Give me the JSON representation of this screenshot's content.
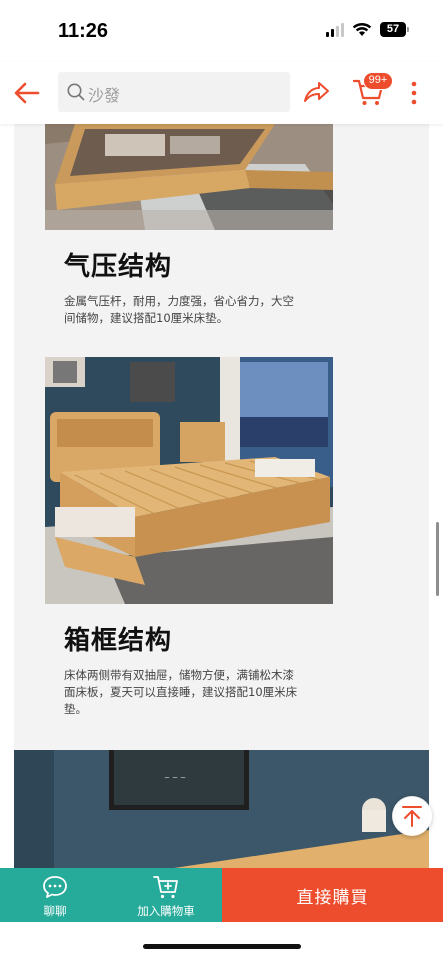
{
  "status_bar": {
    "time": "11:26",
    "battery": "57"
  },
  "header": {
    "search_placeholder": "沙發",
    "cart_badge": "99+"
  },
  "sections": [
    {
      "title": "气压结构",
      "description": "金属气压杆，耐用，力度强，省心省力，大空间储物，建议搭配10厘米床垫。"
    },
    {
      "title": "箱框结构",
      "description": "床体两侧带有双抽屉，储物方便，满铺松木漆面床板，夏天可以直接睡，建议搭配10厘米床垫。"
    }
  ],
  "bottom_bar": {
    "chat_label": "聊聊",
    "add_to_cart_label": "加入購物車",
    "buy_now_label": "直接購買"
  },
  "colors": {
    "accent": "#ee4d2d",
    "teal": "#26aa99",
    "panel_bg": "#f3f3f4"
  },
  "icons": [
    "back-arrow-icon",
    "search-icon",
    "share-icon",
    "cart-icon",
    "more-vertical-icon",
    "chat-icon",
    "add-cart-icon",
    "scroll-to-top-icon"
  ]
}
